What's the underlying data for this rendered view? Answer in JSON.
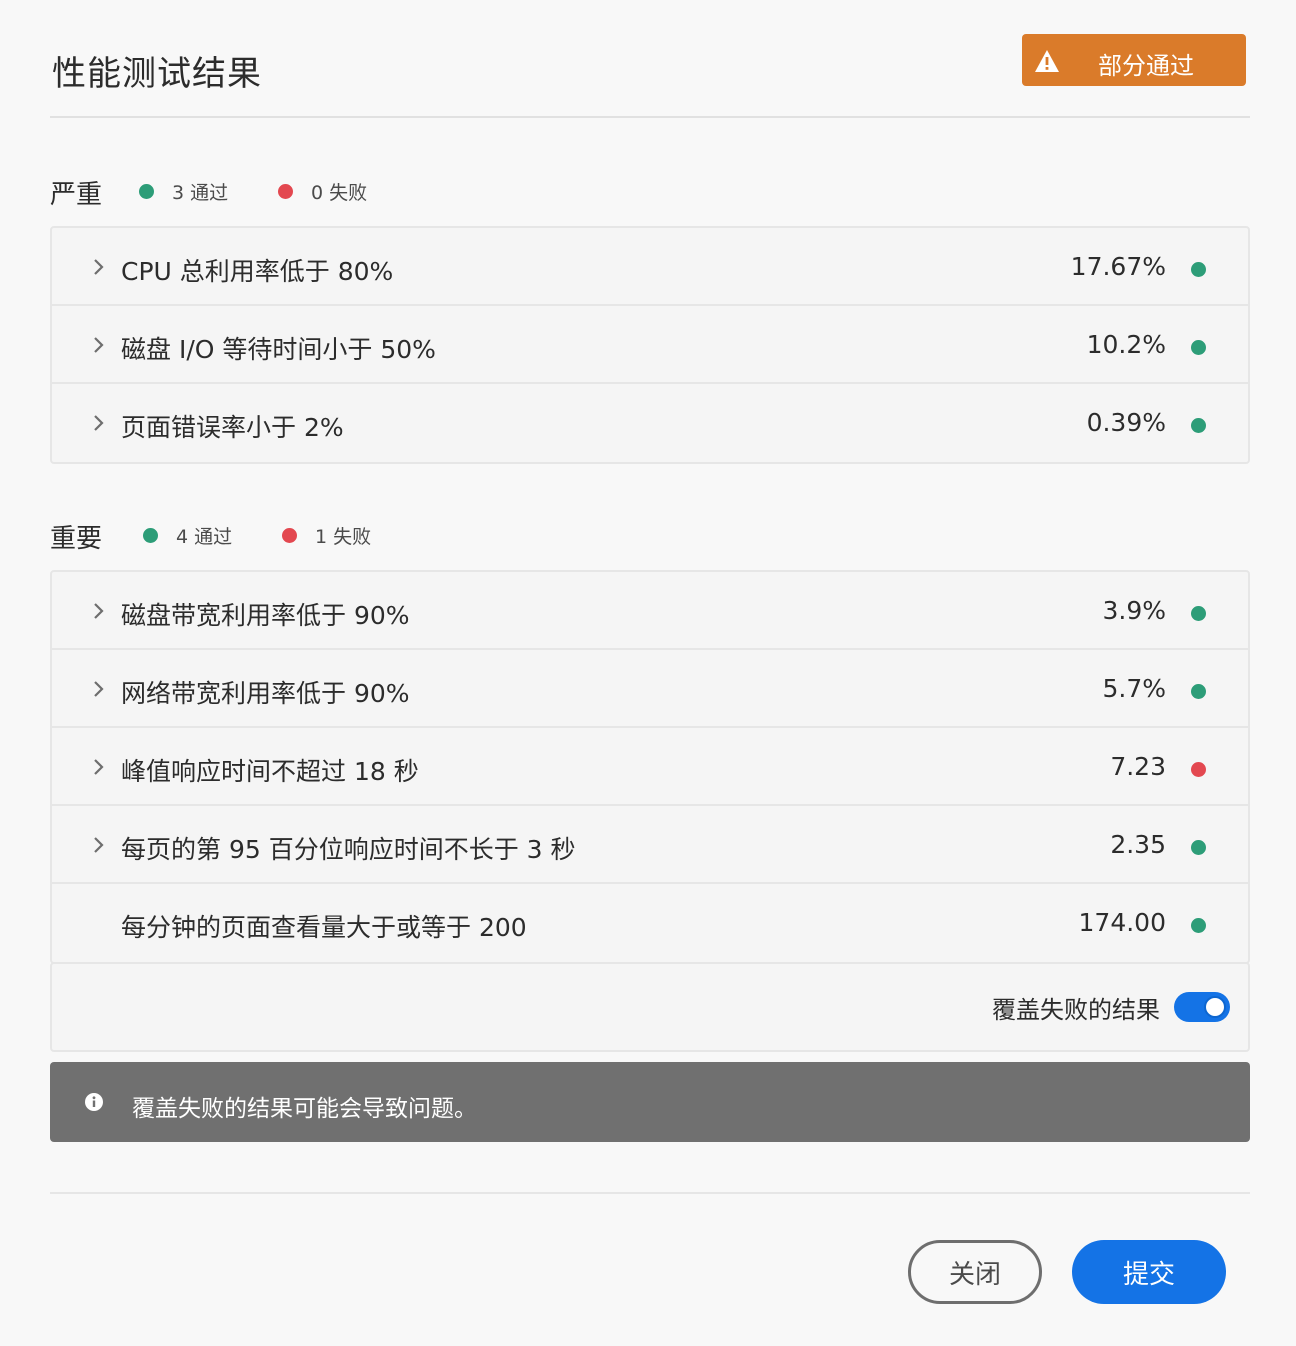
{
  "dialog": {
    "title": "性能测试结果",
    "status_badge": "部分通过",
    "status_color": "#da7b2a"
  },
  "sections": [
    {
      "title": "严重",
      "passed": "3 通过",
      "failed": "0 失败",
      "rows": [
        {
          "label": "CPU 总利用率低于 80%",
          "value": "17.67%",
          "status": "pass",
          "expandable": true
        },
        {
          "label": "磁盘 I/O 等待时间小于 50%",
          "value": "10.2%",
          "status": "pass",
          "expandable": true
        },
        {
          "label": "页面错误率小于 2%",
          "value": "0.39%",
          "status": "pass",
          "expandable": true
        }
      ]
    },
    {
      "title": "重要",
      "passed": "4 通过",
      "failed": "1 失败",
      "rows": [
        {
          "label": "磁盘带宽利用率低于 90%",
          "value": "3.9%",
          "status": "pass",
          "expandable": true
        },
        {
          "label": "网络带宽利用率低于 90%",
          "value": "5.7%",
          "status": "pass",
          "expandable": true
        },
        {
          "label": "峰值响应时间不超过 18 秒",
          "value": "7.23",
          "status": "fail",
          "expandable": true
        },
        {
          "label": "每页的第 95 百分位响应时间不长于 3 秒",
          "value": "2.35",
          "status": "pass",
          "expandable": true
        },
        {
          "label": "每分钟的页面查看量大于或等于 200",
          "value": "174.00",
          "status": "pass",
          "expandable": false
        }
      ]
    }
  ],
  "override": {
    "label": "覆盖失败的结果",
    "enabled": true
  },
  "info": {
    "message": "覆盖失败的结果可能会导致问题。"
  },
  "footer": {
    "close_label": "关闭",
    "submit_label": "提交"
  },
  "colors": {
    "pass": "#2d9d78",
    "fail": "#e34850",
    "accent": "#1473e6"
  },
  "icons": {
    "status_badge": "warning-icon",
    "row_expand": "chevron-right-icon",
    "info": "info-icon"
  }
}
